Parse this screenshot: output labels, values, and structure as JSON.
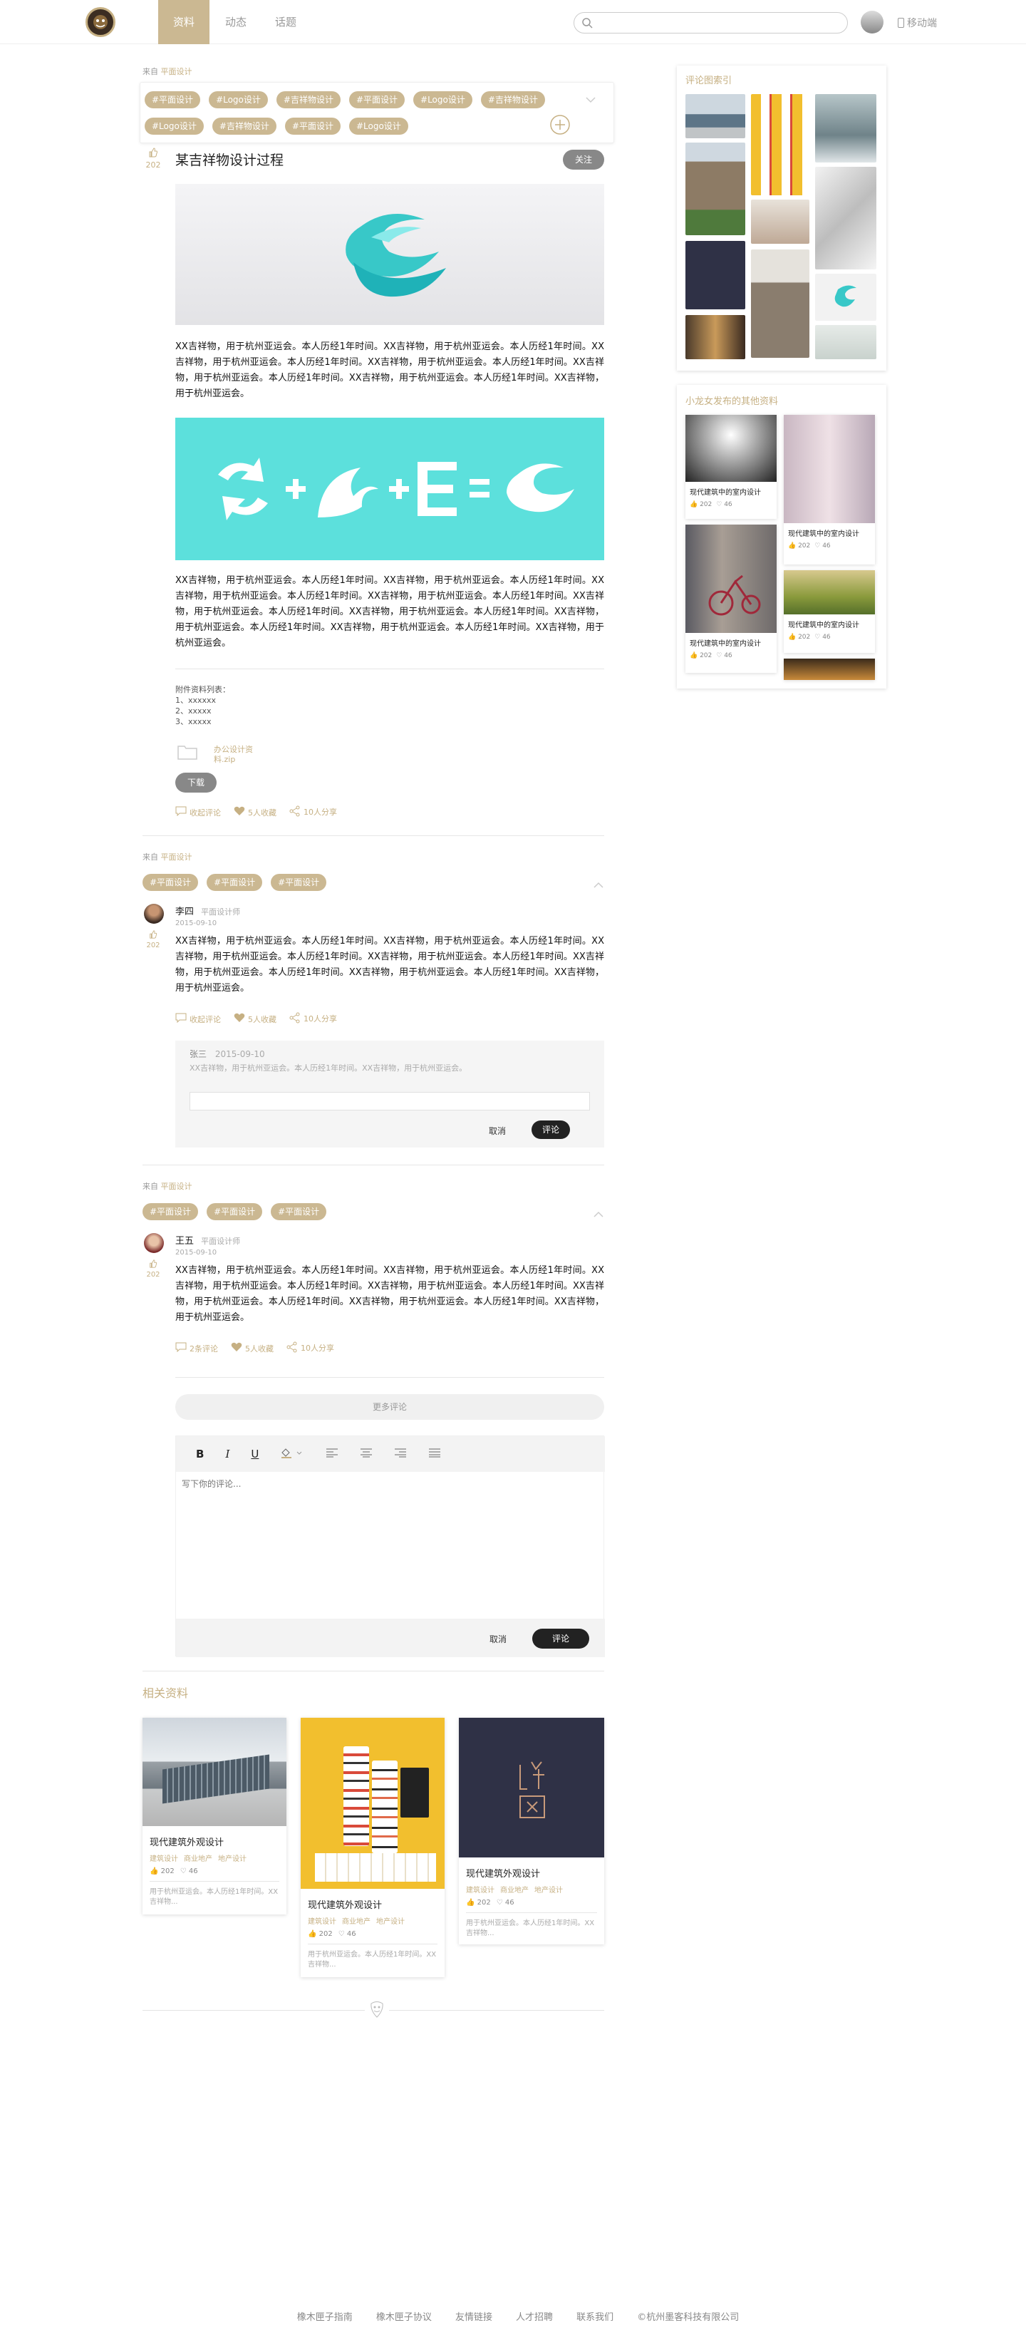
{
  "nav": {
    "tabs": [
      "资料",
      "动态",
      "话题"
    ],
    "search_placeholder": "",
    "mobile_label": "移动端"
  },
  "post": {
    "from_prefix": "来自",
    "from_source": "平面设计",
    "tags_row1": [
      "#平面设计",
      "#Logo设计",
      "#吉祥物设计",
      "#平面设计",
      "#Logo设计",
      "#吉祥物设计"
    ],
    "tags_row2": [
      "#Logo设计",
      "#吉祥物设计",
      "#平面设计",
      "#Logo设计"
    ],
    "like_count": "202",
    "title": "某吉祥物设计过程",
    "follow_label": "关注",
    "paragraph1": "XX吉祥物，用于杭州亚运会。本人历经1年时间。XX吉祥物，用于杭州亚运会。本人历经1年时间。XX吉祥物，用于杭州亚运会。本人历经1年时间。XX吉祥物，用于杭州亚运会。本人历经1年时间。XX吉祥物，用于杭州亚运会。本人历经1年时间。XX吉祥物，用于杭州亚运会。本人历经1年时间。XX吉祥物，用于杭州亚运会。",
    "paragraph2": "XX吉祥物，用于杭州亚运会。本人历经1年时间。XX吉祥物，用于杭州亚运会。本人历经1年时间。XX吉祥物，用于杭州亚运会。本人历经1年时间。XX吉祥物，用于杭州亚运会。本人历经1年时间。XX吉祥物，用于杭州亚运会。本人历经1年时间。XX吉祥物，用于杭州亚运会。本人历经1年时间。XX吉祥物，用于杭州亚运会。本人历经1年时间。XX吉祥物，用于杭州亚运会。本人历经1年时间。XX吉祥物，用于杭州亚运会。",
    "attach_title": "附件资料列表：",
    "attach_items": [
      "1、xxxxxx",
      "2、xxxxx",
      "3、xxxxx"
    ],
    "file_name": "办公设计资料.zip",
    "download_label": "下载",
    "actions": {
      "comment": "收起评论",
      "collect": "5人收藏",
      "share": "10人分享"
    }
  },
  "comments": [
    {
      "from_prefix": "来自",
      "from_source": "平面设计",
      "tags": [
        "#平面设计",
        "#平面设计",
        "#平面设计"
      ],
      "name": "李四",
      "role": "平面设计师",
      "date": "2015-09-10",
      "like_count": "202",
      "text": "XX吉祥物，用于杭州亚运会。本人历经1年时间。XX吉祥物，用于杭州亚运会。本人历经1年时间。XX吉祥物，用于杭州亚运会。本人历经1年时间。XX吉祥物，用于杭州亚运会。本人历经1年时间。XX吉祥物，用于杭州亚运会。本人历经1年时间。XX吉祥物，用于杭州亚运会。本人历经1年时间。XX吉祥物，用于杭州亚运会。",
      "actions": {
        "comment": "收起评论",
        "collect": "5人收藏",
        "share": "10人分享"
      },
      "reply": {
        "name": "张三",
        "date": "2015-09-10",
        "text": "XX吉祥物，用于杭州亚运会。本人历经1年时间。XX吉祥物，用于杭州亚运会。"
      },
      "cancel_label": "取消",
      "submit_label": "评论"
    },
    {
      "from_prefix": "来自",
      "from_source": "平面设计",
      "tags": [
        "#平面设计",
        "#平面设计",
        "#平面设计"
      ],
      "name": "王五",
      "role": "平面设计师",
      "date": "2015-09-10",
      "like_count": "202",
      "text": "XX吉祥物，用于杭州亚运会。本人历经1年时间。XX吉祥物，用于杭州亚运会。本人历经1年时间。XX吉祥物，用于杭州亚运会。本人历经1年时间。XX吉祥物，用于杭州亚运会。本人历经1年时间。XX吉祥物，用于杭州亚运会。本人历经1年时间。XX吉祥物，用于杭州亚运会。本人历经1年时间。XX吉祥物，用于杭州亚运会。",
      "actions": {
        "comment": "2条评论",
        "collect": "5人收藏",
        "share": "10人分享"
      }
    }
  ],
  "more_comments_label": "更多评论",
  "editor": {
    "placeholder": "写下你的评论...",
    "cancel_label": "取消",
    "submit_label": "评论"
  },
  "related": {
    "title": "相关资料",
    "cards": [
      {
        "title": "现代建筑外观设计",
        "tags": [
          "建筑设计",
          "商业地产",
          "地产设计"
        ],
        "likes": "202",
        "hearts": "46",
        "desc": "用于杭州亚运会。本人历经1年时间。XX吉祥物..."
      },
      {
        "title": "现代建筑外观设计",
        "tags": [
          "建筑设计",
          "商业地产",
          "地产设计"
        ],
        "likes": "202",
        "hearts": "46",
        "desc": "用于杭州亚运会。本人历经1年时间。XX吉祥物..."
      },
      {
        "title": "现代建筑外观设计",
        "tags": [
          "建筑设计",
          "商业地产",
          "地产设计"
        ],
        "likes": "202",
        "hearts": "46",
        "desc": "用于杭州亚运会。本人历经1年时间。XX吉祥物..."
      }
    ]
  },
  "sidebar": {
    "index_title": "评论图索引",
    "others_title": "小龙女发布的其他资料",
    "others": [
      {
        "title": "现代建筑中的室内设计",
        "likes": "202",
        "hearts": "46"
      },
      {
        "title": "现代建筑中的室内设计",
        "likes": "202",
        "hearts": "46"
      },
      {
        "title": "现代建筑中的室内设计",
        "likes": "202",
        "hearts": "46"
      },
      {
        "title": "现代建筑中的室内设计",
        "likes": "202",
        "hearts": "46"
      }
    ]
  },
  "footer": {
    "links": [
      "橡木匣子指南",
      "橡木匣子协议",
      "友情链接",
      "人才招聘",
      "联系我们"
    ],
    "copyright": "©杭州墨客科技有限公司"
  },
  "colors": {
    "accent": "#c6b083",
    "dark": "#222222",
    "teal": "#5ce0dc"
  }
}
